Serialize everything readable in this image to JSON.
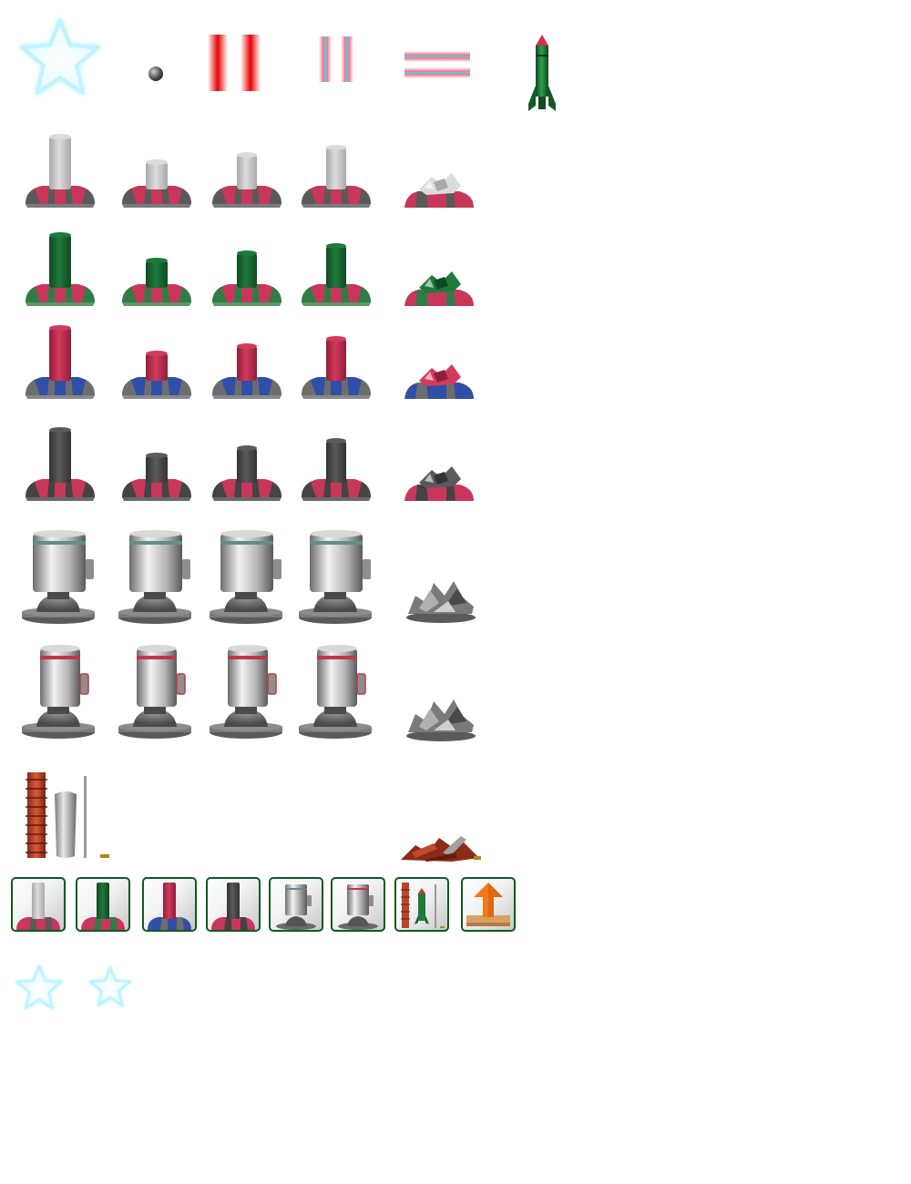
{
  "sheet": {
    "projectiles": [
      "glow-star",
      "cannonball",
      "red-laser-pair",
      "cyan-laser-pair",
      "cyan-laser-horizontal",
      "green-rocket"
    ],
    "tower_rows": [
      {
        "name": "white-cannon-tower",
        "barrel": "#dcdcdc",
        "barrel_shade": "#a9a9a9",
        "base_a": "#c8375a",
        "base_b": "#5a5a5a"
      },
      {
        "name": "green-cannon-tower",
        "barrel": "#1f7a3a",
        "barrel_shade": "#0f4a22",
        "base_a": "#c8375a",
        "base_b": "#2f7d45"
      },
      {
        "name": "red-cannon-tower",
        "barrel": "#d23a5c",
        "barrel_shade": "#8e1f3a",
        "base_a": "#2f4fa8",
        "base_b": "#6d6d6d"
      },
      {
        "name": "dark-cannon-tower",
        "barrel": "#5a5a5a",
        "barrel_shade": "#333333",
        "base_a": "#c8375a",
        "base_b": "#444444"
      }
    ],
    "turret_rows": [
      {
        "name": "teal-stripe-turret",
        "stripe": "#5f8f88"
      },
      {
        "name": "red-stripe-turret",
        "stripe": "#c2354a"
      }
    ],
    "buttons": [
      "white-tower-button",
      "green-tower-button",
      "red-tower-button",
      "dark-tower-button",
      "teal-turret-button",
      "red-turret-button",
      "rocket-silo-button",
      "upgrade-button"
    ],
    "colors": {
      "button_border": "#0d5a22",
      "star_glow": "#bff4ff",
      "upgrade_arrow": "#f07a1a",
      "upgrade_base": "#d9a066"
    }
  }
}
